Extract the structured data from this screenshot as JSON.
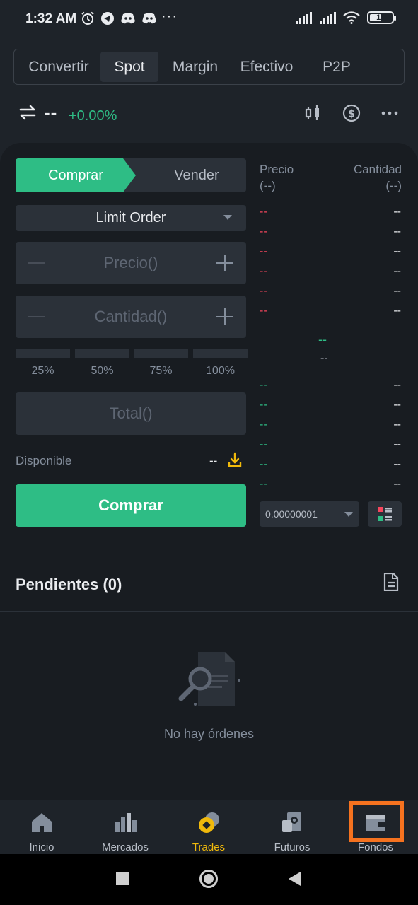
{
  "status_bar": {
    "time": "1:32 AM",
    "battery": "11",
    "overflow": "···",
    "icons": [
      "alarm-icon",
      "telegram-icon",
      "discord-icon",
      "discord-icon",
      "signal-icon",
      "signal-icon",
      "wifi-icon",
      "battery-icon"
    ]
  },
  "tabs": [
    {
      "label": "Convertir",
      "active": false
    },
    {
      "label": "Spot",
      "active": true
    },
    {
      "label": "Margin",
      "active": false
    },
    {
      "label": "Efectivo",
      "active": false
    },
    {
      "label": "P2P",
      "active": false
    }
  ],
  "pair": {
    "name": "--",
    "change": "+0.00%",
    "icons": [
      "swap-icon",
      "candlestick-chart-icon",
      "dollar-icon",
      "more-icon"
    ]
  },
  "trade_form": {
    "buy_tab": "Comprar",
    "sell_tab": "Vender",
    "order_type": "Limit Order",
    "price_placeholder": "Precio()",
    "amount_placeholder": "Cantidad()",
    "percentages": [
      "25%",
      "50%",
      "75%",
      "100%"
    ],
    "total_placeholder": "Total()",
    "available_label": "Disponible",
    "available_value": "--",
    "submit_label": "Comprar"
  },
  "order_book": {
    "price_header": "Precio",
    "price_unit": "(--)",
    "amount_header": "Cantidad",
    "amount_unit": "(--)",
    "asks": [
      {
        "price": "--",
        "amount": "--"
      },
      {
        "price": "--",
        "amount": "--"
      },
      {
        "price": "--",
        "amount": "--"
      },
      {
        "price": "--",
        "amount": "--"
      },
      {
        "price": "--",
        "amount": "--"
      },
      {
        "price": "--",
        "amount": "--"
      }
    ],
    "last_price": "--",
    "last_price_sub": "--",
    "bids": [
      {
        "price": "--",
        "amount": "--"
      },
      {
        "price": "--",
        "amount": "--"
      },
      {
        "price": "--",
        "amount": "--"
      },
      {
        "price": "--",
        "amount": "--"
      },
      {
        "price": "--",
        "amount": "--"
      },
      {
        "price": "--",
        "amount": "--"
      }
    ],
    "precision": "0.00000001"
  },
  "pending": {
    "title": "Pendientes (0)",
    "empty_text": "No hay órdenes"
  },
  "bottom_nav": [
    {
      "label": "Inicio",
      "icon": "home-icon",
      "active": false
    },
    {
      "label": "Mercados",
      "icon": "markets-icon",
      "active": false
    },
    {
      "label": "Trades",
      "icon": "trades-icon",
      "active": true
    },
    {
      "label": "Futuros",
      "icon": "futures-icon",
      "active": false
    },
    {
      "label": "Fondos",
      "icon": "wallet-icon",
      "active": false,
      "highlighted": true
    }
  ],
  "colors": {
    "background": "#181c21",
    "surface": "#2b3139",
    "buy_green": "#2ebd85",
    "sell_red": "#f6465d",
    "accent": "#f0b90b",
    "highlight": "#f5721f"
  }
}
